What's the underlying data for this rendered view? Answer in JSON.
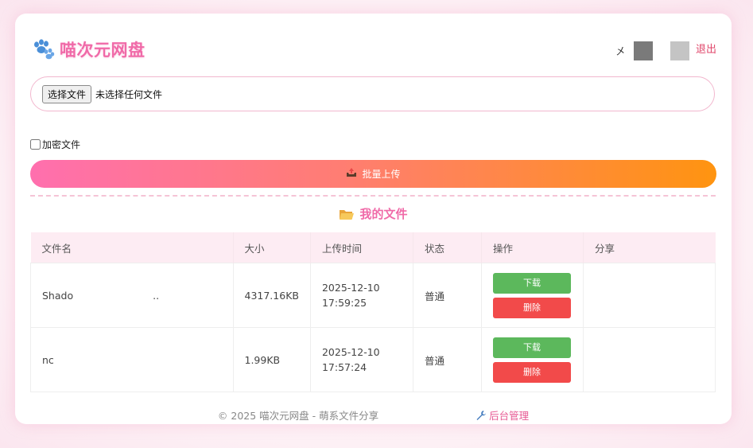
{
  "header": {
    "title": "喵次元网盘",
    "user_glyph": "㐅",
    "logout_label": "退出",
    "paw_icon": "paw-icon"
  },
  "upload": {
    "choose_file_label": "选择文件",
    "no_file_text": "未选择任何文件",
    "encrypt_label": "加密文件",
    "encrypt_checked": false,
    "batch_upload_label": "批量上传",
    "upload_icon": "upload-tray-icon"
  },
  "files_section": {
    "title": "我的文件",
    "icon": "folder-icon",
    "columns": [
      "文件名",
      "大小",
      "上传时间",
      "状态",
      "操作",
      "分享"
    ],
    "rows": [
      {
        "name_start": "Shado",
        "name_end": "..",
        "size": "4317.16KB",
        "date": "2025-12-10",
        "time": "17:59:25",
        "status": "普通",
        "download_label": "下载",
        "delete_label": "删除",
        "share": ""
      },
      {
        "name_start": "nc",
        "name_end": "",
        "size": "1.99KB",
        "date": "2025-12-10",
        "time": "17:57:24",
        "status": "普通",
        "download_label": "下载",
        "delete_label": "删除",
        "share": ""
      }
    ]
  },
  "footer": {
    "copyright": "© 2025 喵次元网盘 - 萌系文件分享",
    "admin_label": "后台管理",
    "admin_icon": "wrench-icon"
  },
  "colors": {
    "brand_pink": "#f06aa8",
    "gradient_start": "#ff6fae",
    "gradient_end": "#ff9410",
    "download_green": "#5cb85c",
    "delete_red": "#f24a4a",
    "logout_red": "#e0476b"
  }
}
